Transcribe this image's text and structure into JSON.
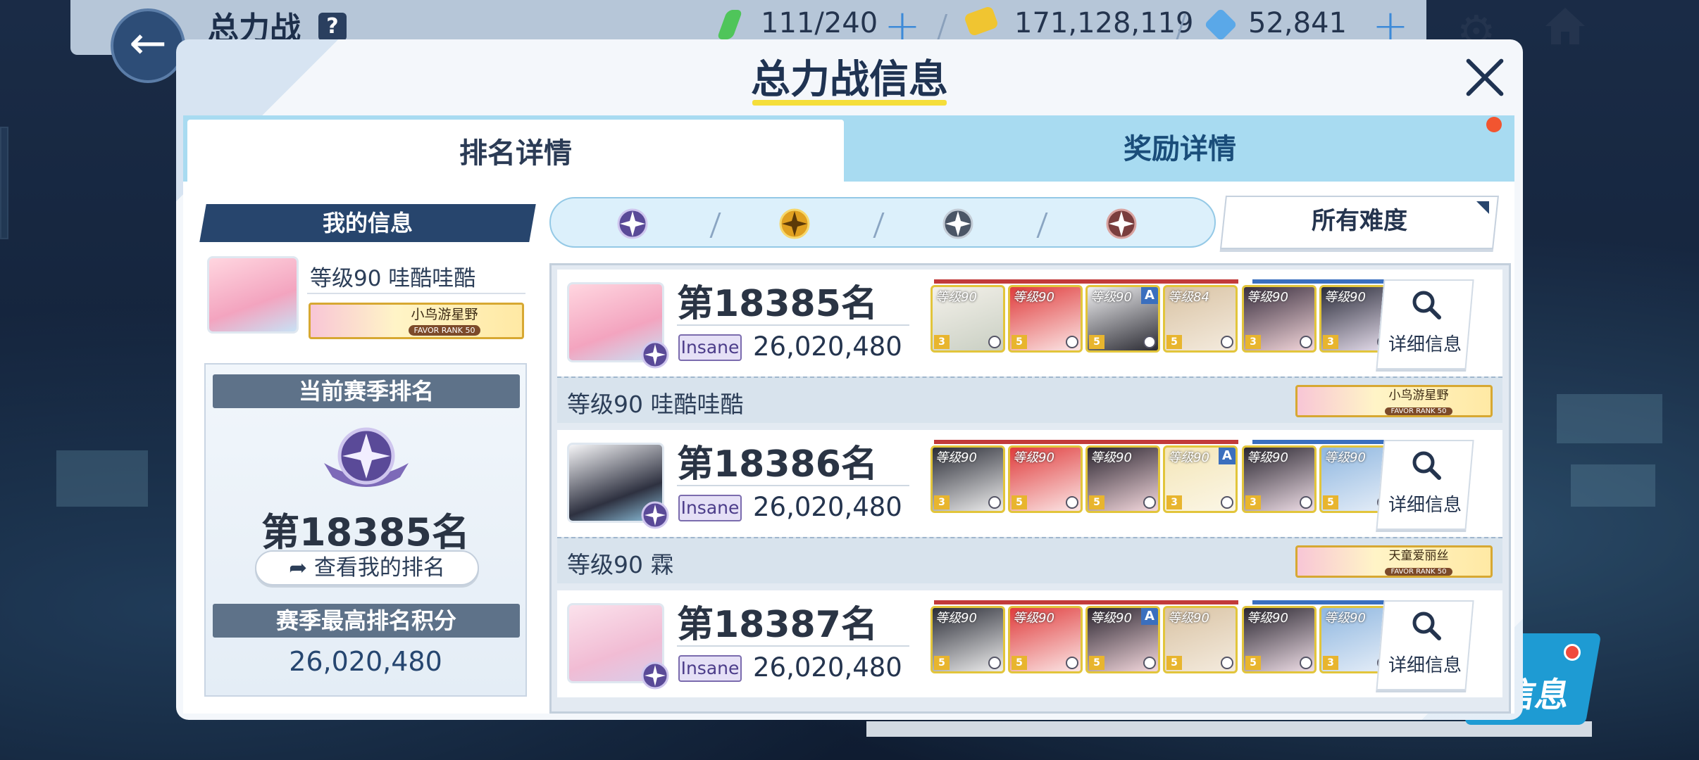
{
  "topbar": {
    "title": "总力战",
    "help": "?",
    "stamina": "111/240",
    "credits": "171,128,119",
    "gems": "52,841"
  },
  "side_button": {
    "label": "信息"
  },
  "modal": {
    "title": "总力战信息",
    "tabs": [
      {
        "label": "排名详情",
        "active": true
      },
      {
        "label": "奖励详情",
        "active": false
      }
    ],
    "my_info": {
      "header": "我的信息",
      "name": "等级90 哇酷哇酷",
      "badge_name": "小鸟游星野",
      "badge_rank": "FAVOR RANK 50",
      "season_header": "当前赛季排名",
      "season_rank": "第18385名",
      "view_button": "查看我的排名",
      "best_header": "赛季最高排名积分",
      "best_score": "26,020,480"
    },
    "filter": {
      "difficulty": "所有难度",
      "tiers": [
        "platinum-tier-icon",
        "gold-tier-icon",
        "silver-tier-icon",
        "bronze-tier-icon"
      ]
    },
    "rankings": [
      {
        "rank": "第18385名",
        "difficulty": "Insane",
        "score": "26,020,480",
        "player": "等级90 哇酷哇酷",
        "badge_name": "小鸟游星野",
        "badge_rank": "FAVOR RANK 50",
        "detail": "详细信息",
        "team": [
          {
            "level": "等级90",
            "star": "3"
          },
          {
            "level": "等级90",
            "star": "5"
          },
          {
            "level": "等级90",
            "star": "5",
            "tag": "A"
          },
          {
            "level": "等级84",
            "star": "5"
          },
          {
            "level": "等级90",
            "star": "3"
          },
          {
            "level": "等级90",
            "star": "3"
          }
        ]
      },
      {
        "rank": "第18386名",
        "difficulty": "Insane",
        "score": "26,020,480",
        "player": "等级90 霖",
        "badge_name": "天童爱丽丝",
        "badge_rank": "FAVOR RANK 50",
        "detail": "详细信息",
        "team": [
          {
            "level": "等级90",
            "star": "3"
          },
          {
            "level": "等级90",
            "star": "5"
          },
          {
            "level": "等级90",
            "star": "5"
          },
          {
            "level": "等级90",
            "star": "3",
            "tag": "A"
          },
          {
            "level": "等级90",
            "star": "3"
          },
          {
            "level": "等级90",
            "star": "5"
          }
        ]
      },
      {
        "rank": "第18387名",
        "difficulty": "Insane",
        "score": "26,020,480",
        "detail": "详细信息",
        "team": [
          {
            "level": "等级90",
            "star": "5"
          },
          {
            "level": "等级90",
            "star": "5"
          },
          {
            "level": "等级90",
            "star": "5",
            "tag": "A"
          },
          {
            "level": "等级90",
            "star": "5"
          },
          {
            "level": "等级90",
            "star": "5"
          },
          {
            "level": "等级90",
            "star": "3"
          }
        ]
      }
    ]
  },
  "colors": {
    "accent_yellow": "#f5de3a",
    "tab_blue": "#a8dbf1",
    "header_navy": "#27456d",
    "insane_purple": "#7b6cae"
  }
}
